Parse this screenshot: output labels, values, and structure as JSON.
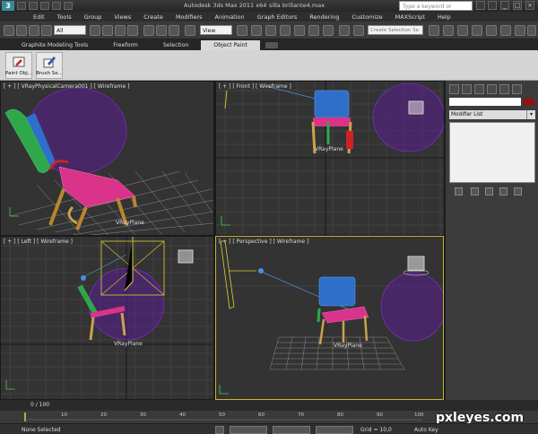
{
  "app": {
    "title": "Autodesk 3ds Max  2011 x64",
    "file": "silla brillante4.max",
    "search_placeholder": "Type a keyword or phrase"
  },
  "menu": [
    "Edit",
    "Tools",
    "Group",
    "Views",
    "Create",
    "Modifiers",
    "Animation",
    "Graph Editors",
    "Rendering",
    "Customize",
    "MAXScript",
    "Help"
  ],
  "toolbar": {
    "filter_value": "All",
    "view_value": "View",
    "selection_set_placeholder": "Create Selection Se"
  },
  "ribbon": {
    "tabs": [
      "Graphite Modeling Tools",
      "Freeform",
      "Selection",
      "Object Paint"
    ],
    "active_tab": "Object Paint",
    "buttons": [
      "Paint Obj...",
      "Brush Se..."
    ]
  },
  "viewports": {
    "top_left": {
      "label": "[ + ] [ VRayPhysicalCamera001 ] [ Wireframe ]",
      "plane_label": "VRayPlane"
    },
    "top_right": {
      "label": "[ + ] [ Front ] [ Wireframe ]",
      "plane_label": "VRayPlane"
    },
    "bottom_left": {
      "label": "[ + ] [ Left ] [ Wireframe ]",
      "plane_label": "VRayPlane"
    },
    "bottom_right": {
      "label": "[ + ] [ Perspective ] [ Wireframe ]",
      "plane_label": "VRayPlane"
    }
  },
  "command_panel": {
    "modifier_list": "Modifier List"
  },
  "timeline": {
    "frame_counter": "0 / 100",
    "ticks": [
      "10",
      "20",
      "30",
      "40",
      "50",
      "60",
      "70",
      "80",
      "90",
      "100"
    ]
  },
  "status": {
    "selection": "None Selected",
    "grid": "Grid = 10,0",
    "autokey": "Auto Key"
  },
  "watermark": "pxleyes.com",
  "colors": {
    "chair_seat": "#d9338a",
    "chair_back": "#2f86c9",
    "sphere": "#7a1fd1",
    "viewport_bg": "#333333",
    "active_border": "#c9b22e"
  }
}
